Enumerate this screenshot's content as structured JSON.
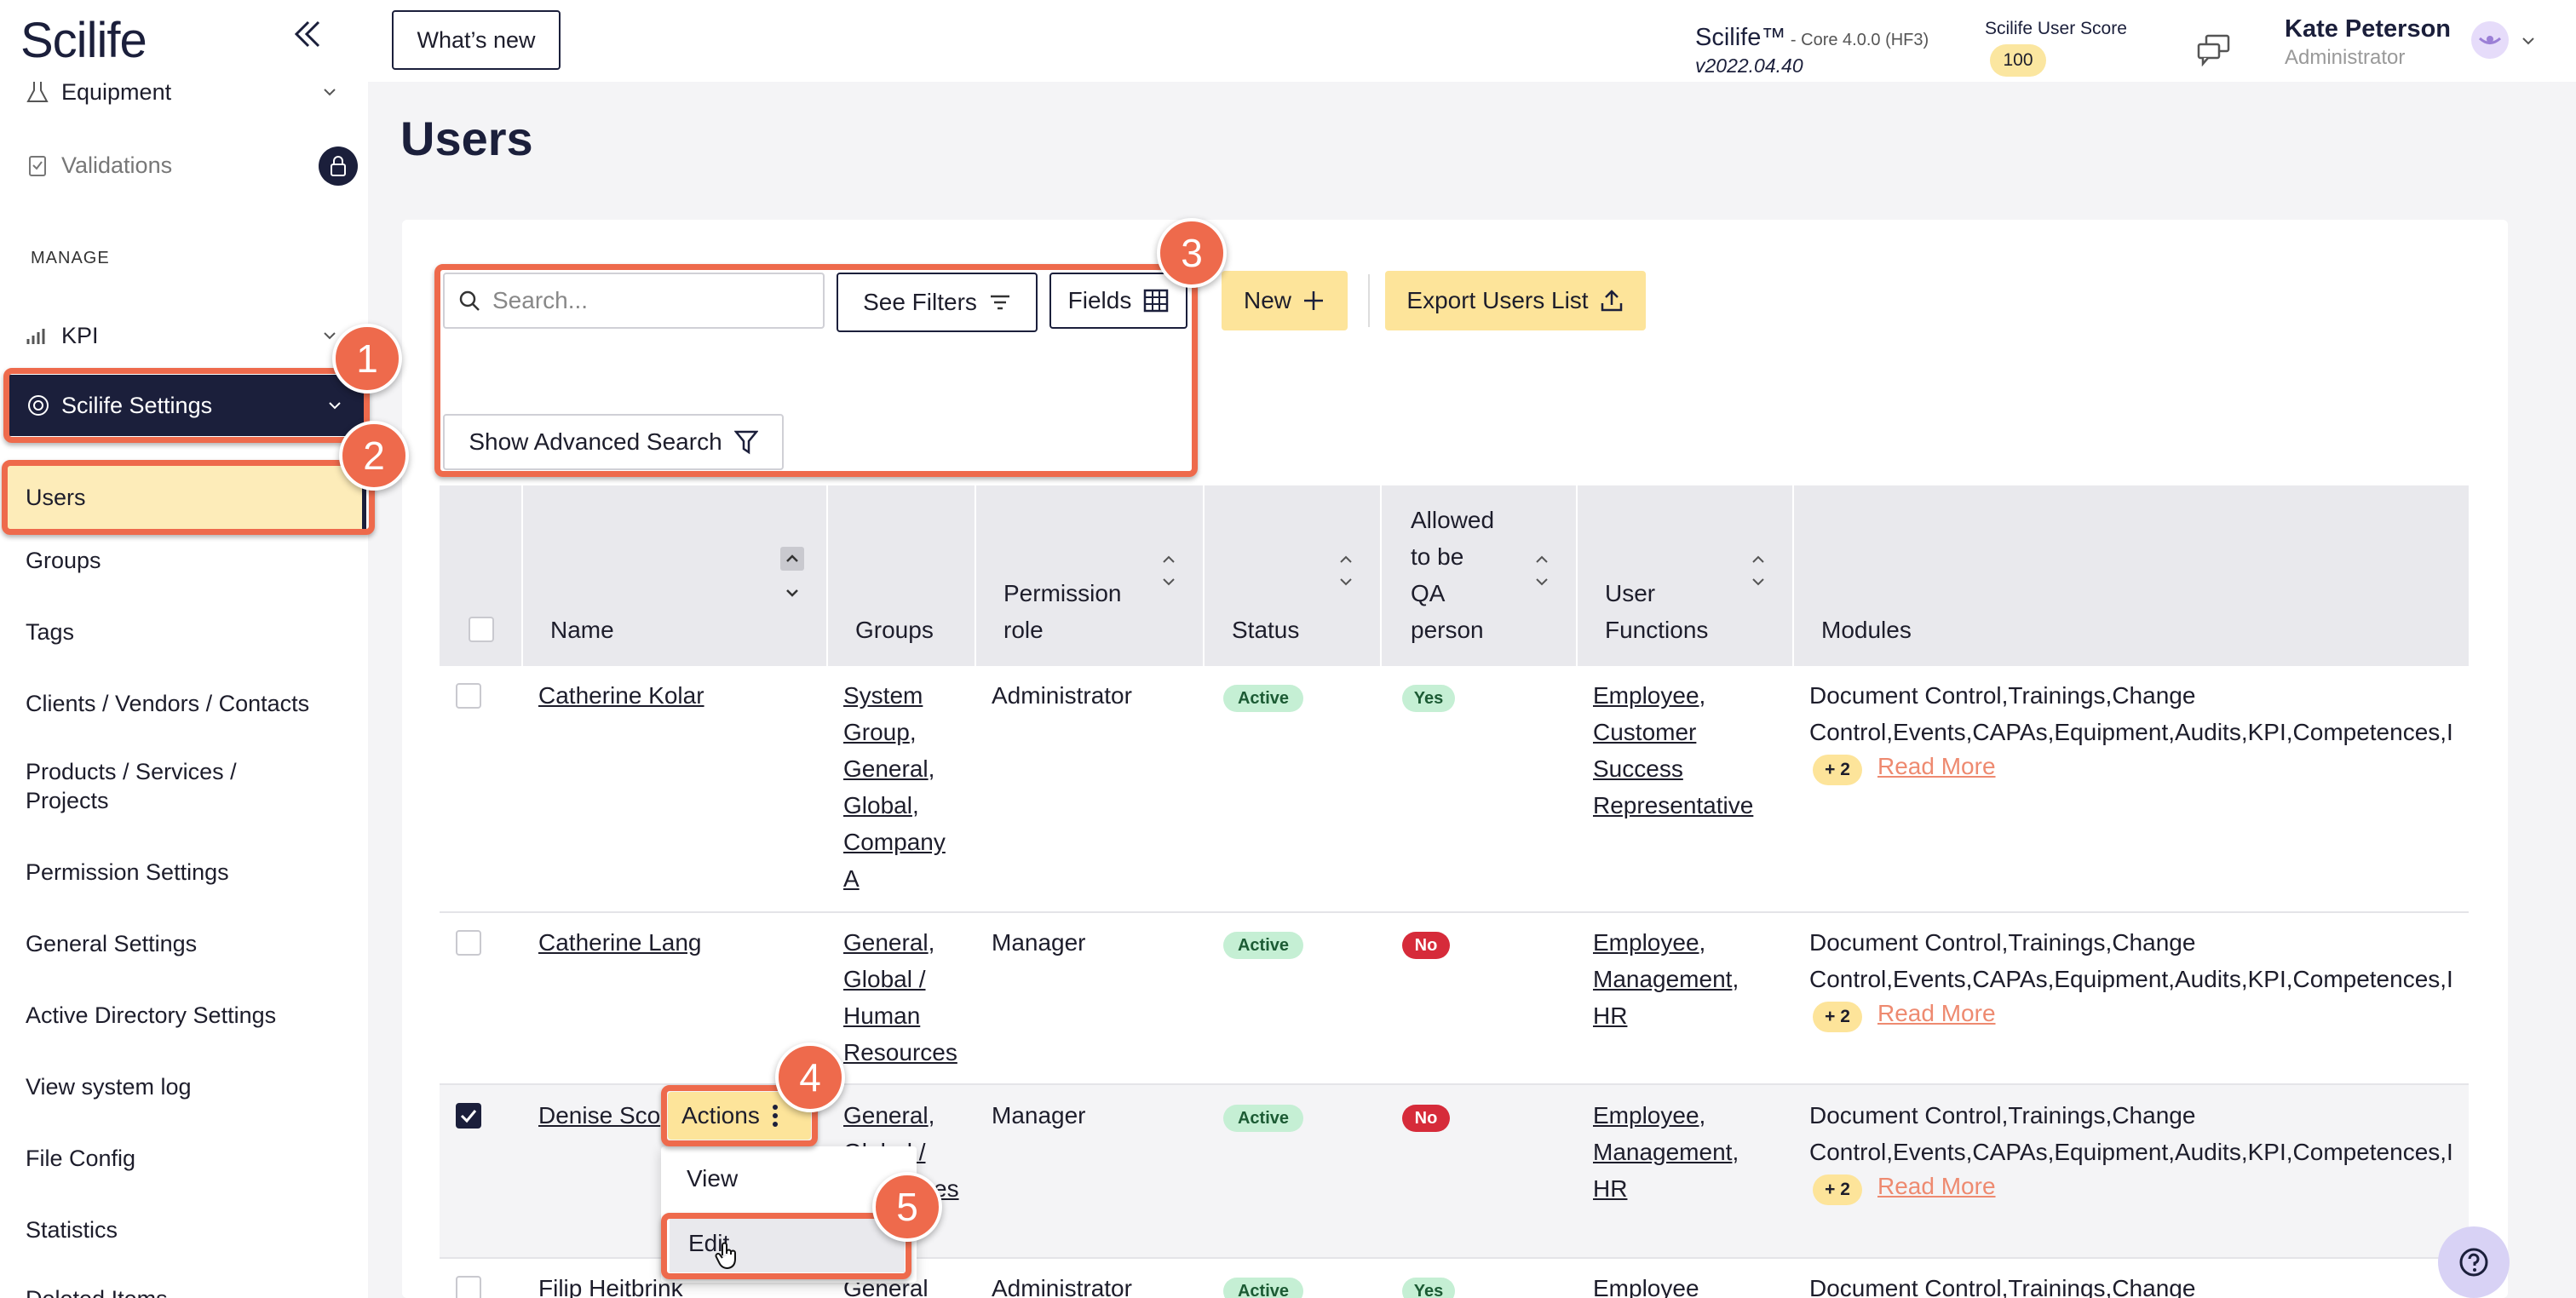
{
  "app": {
    "logo": "Scilife"
  },
  "sidebar": {
    "equipment": "Equipment",
    "validations": "Validations",
    "manage": "MANAGE",
    "kpi": "KPI",
    "scilife_settings": "Scilife Settings",
    "users": "Users",
    "items": [
      "Groups",
      "Tags",
      "Clients / Vendors / Contacts",
      "Products / Services /",
      "Projects",
      "Permission Settings",
      "General Settings",
      "Active Directory Settings",
      "View system log",
      "File Config",
      "Statistics",
      "Deleted Items"
    ]
  },
  "topbar": {
    "whats_new": "What’s new",
    "product": "Scilife™",
    "core": " - Core 4.0.0 (HF3)",
    "version": "v2022.04.40",
    "score_label": "Scilife User Score",
    "score_value": "100",
    "user_name": "Kate Peterson",
    "user_role": "Administrator"
  },
  "page": {
    "title": "Users"
  },
  "toolbar": {
    "search_placeholder": "Search...",
    "see_filters": "See Filters",
    "fields": "Fields",
    "new": "New",
    "export": "Export Users List",
    "advanced_search": "Show Advanced Search"
  },
  "table": {
    "headers": {
      "name": "Name",
      "groups": "Groups",
      "permission_role_1": "Permission",
      "permission_role_2": "role",
      "status": "Status",
      "qa_1": "Allowed",
      "qa_2": "to be",
      "qa_3": "QA",
      "qa_4": "person",
      "functions_1": "User",
      "functions_2": "Functions",
      "modules": "Modules"
    },
    "rows": [
      {
        "name": "Catherine Kolar",
        "groups": [
          "System",
          "Group",
          "General",
          "Global",
          "Company",
          "A"
        ],
        "role": "Administrator",
        "status": "Active",
        "qa": "Yes",
        "functions": [
          "Employee",
          "Customer",
          "Success",
          "Representative"
        ],
        "modules_1": "Document Control,Trainings,Change",
        "modules_2": "Control,Events,CAPAs,Equipment,Audits,KPI,Competences,I",
        "more": "+ 2",
        "read_more": "Read More"
      },
      {
        "name": "Catherine Lang",
        "groups": [
          "General",
          "Global /",
          "Human",
          "Resources"
        ],
        "role": "Manager",
        "status": "Active",
        "qa": "No",
        "functions": [
          "Employee",
          "Management",
          "HR"
        ],
        "modules_1": "Document Control,Trainings,Change",
        "modules_2": "Control,Events,CAPAs,Equipment,Audits,KPI,Competences,I",
        "more": "+ 2",
        "read_more": "Read More"
      },
      {
        "name": "Denise Sco",
        "groups": [
          "General",
          "Global /",
          "ces"
        ],
        "role": "Manager",
        "status": "Active",
        "qa": "No",
        "functions": [
          "Employee",
          "Management",
          "HR"
        ],
        "modules_1": "Document Control,Trainings,Change",
        "modules_2": "Control,Events,CAPAs,Equipment,Audits,KPI,Competences,I",
        "more": "+ 2",
        "read_more": "Read More"
      },
      {
        "name": "Filip Heitbrink",
        "groups": [
          "General"
        ],
        "role": "Administrator",
        "status": "Active",
        "qa": "Yes",
        "functions": [
          "Employee"
        ],
        "modules_1": "Document Control,Trainings,Change"
      }
    ]
  },
  "actions_menu": {
    "button": "Actions",
    "view": "View",
    "edit": "Edit"
  },
  "callouts": [
    "1",
    "2",
    "3",
    "4",
    "5"
  ],
  "colors": {
    "accent": "#ee6a4c",
    "navy": "#1b1f3b",
    "yellow": "#fde49a"
  }
}
